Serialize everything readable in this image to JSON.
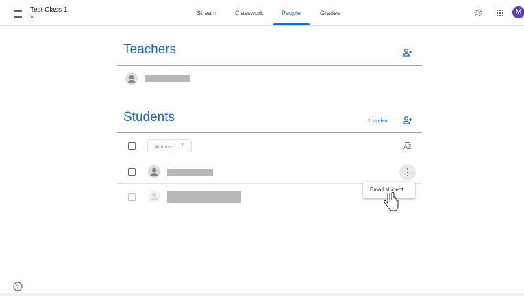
{
  "header": {
    "class_name": "Test Class 1",
    "section": "A",
    "tabs": [
      "Stream",
      "Classwork",
      "People",
      "Grades"
    ],
    "active_tab": "People",
    "avatar_letter": "M",
    "avatar_color": "#5c3fbf"
  },
  "teachers": {
    "title": "Teachers"
  },
  "students": {
    "title": "Students",
    "count_label": "1 student",
    "actions_label": "Actions"
  },
  "row_menu": {
    "email_label": "Email student"
  },
  "icons": {
    "menu": "hamburger-menu-icon",
    "settings": "gear-icon",
    "apps": "apps-grid-icon",
    "add_person": "person-add-icon",
    "sort": "sort-az-icon",
    "more": "more-vert-icon",
    "help": "help-icon",
    "cursor": "hand-pointer-icon"
  },
  "colors": {
    "accent": "#1967d2",
    "redacted": "#b7b7b7"
  }
}
